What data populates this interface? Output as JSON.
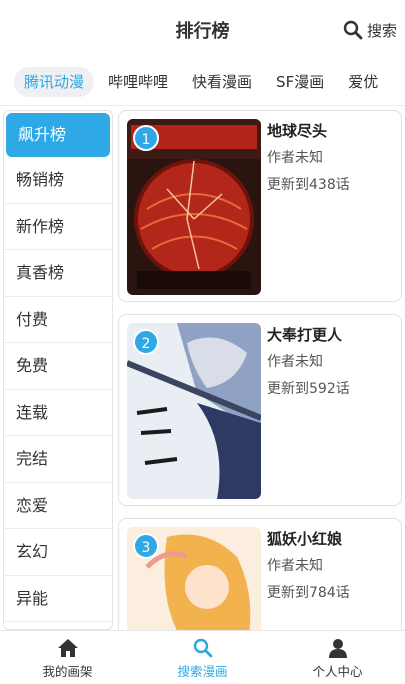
{
  "header": {
    "title": "排行榜",
    "search_label": "搜索"
  },
  "tabs": [
    {
      "label": "腾讯动漫",
      "active": true
    },
    {
      "label": "哔哩哔哩",
      "active": false
    },
    {
      "label": "快看漫画",
      "active": false
    },
    {
      "label": "SF漫画",
      "active": false
    },
    {
      "label": "爱优",
      "active": false
    }
  ],
  "categories": [
    {
      "label": "飙升榜",
      "active": true
    },
    {
      "label": "畅销榜"
    },
    {
      "label": "新作榜"
    },
    {
      "label": "真香榜"
    },
    {
      "label": "付费"
    },
    {
      "label": "免费"
    },
    {
      "label": "连载"
    },
    {
      "label": "完结"
    },
    {
      "label": "恋爱"
    },
    {
      "label": "玄幻"
    },
    {
      "label": "异能"
    }
  ],
  "comics": [
    {
      "rank": "1",
      "title": "地球尽头",
      "author": "作者未知",
      "update": "更新到438话"
    },
    {
      "rank": "2",
      "title": "大奉打更人",
      "author": "作者未知",
      "update": "更新到592话"
    },
    {
      "rank": "3",
      "title": "狐妖小红娘",
      "author": "作者未知",
      "update": "更新到784话"
    }
  ],
  "bottom_nav": [
    {
      "label": "我的画架",
      "icon": "home-icon"
    },
    {
      "label": "搜索漫画",
      "icon": "search-icon",
      "active": true
    },
    {
      "label": "个人中心",
      "icon": "person-icon"
    }
  ],
  "colors": {
    "accent": "#2fa9e6",
    "text": "#333333",
    "border": "#e4e4e4"
  }
}
